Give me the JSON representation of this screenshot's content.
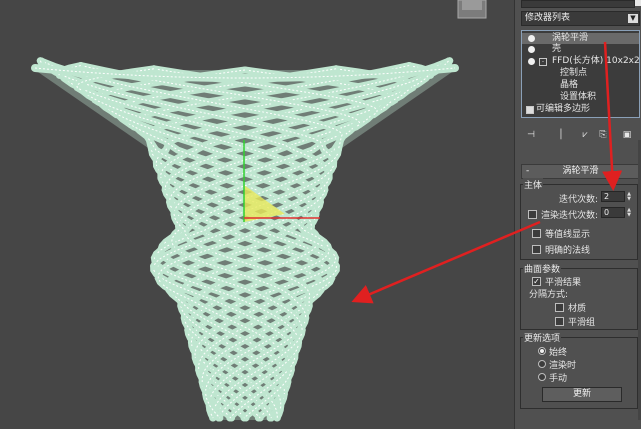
{
  "colors": {
    "viewport_bg": "#464646",
    "panel_bg": "#505050",
    "mesh_fill": "#bfe6d0",
    "mesh_wire": "#ffffff",
    "arrow": "#e02020",
    "gizmo_yellow": "#e8e85a"
  },
  "icons": {
    "viewcube": "viewcube-icon",
    "light_bulb": "light-bulb-icon",
    "pin": "pin-icon",
    "dropdown": "chevron-down-icon"
  },
  "modifier_list": {
    "label": "修改器列表"
  },
  "stack": {
    "items": [
      {
        "label": "涡轮平滑",
        "selected": true
      },
      {
        "label": "壳"
      },
      {
        "label": "FFD(长方体) 10x2x2"
      },
      {
        "label": "控制点"
      },
      {
        "label": "晶格"
      },
      {
        "label": "设置体积"
      },
      {
        "label": "可编辑多边形"
      }
    ]
  },
  "stack_tools": [
    "⊣",
    "│",
    "⩗",
    "⎘",
    "▣"
  ],
  "rollout": {
    "title": "涡轮平滑",
    "collapse": "-",
    "main": {
      "label": "主体",
      "iterations_label": "迭代次数:",
      "iterations_value": "2",
      "render_iters_label": "渲染迭代次数:",
      "render_iters_value": "0",
      "isoline_label": "等值线显示",
      "explicit_normals_label": "明确的法线"
    },
    "surface": {
      "label": "曲面参数",
      "smooth_result_label": "平滑结果",
      "smooth_result_checked": "✓",
      "separate_label": "分隔方式:",
      "material_label": "材质",
      "smoothing_groups_label": "平滑组"
    },
    "update": {
      "label": "更新选项",
      "always_label": "始终",
      "when_render_label": "渲染时",
      "manual_label": "手动",
      "update_button": "更新"
    }
  }
}
